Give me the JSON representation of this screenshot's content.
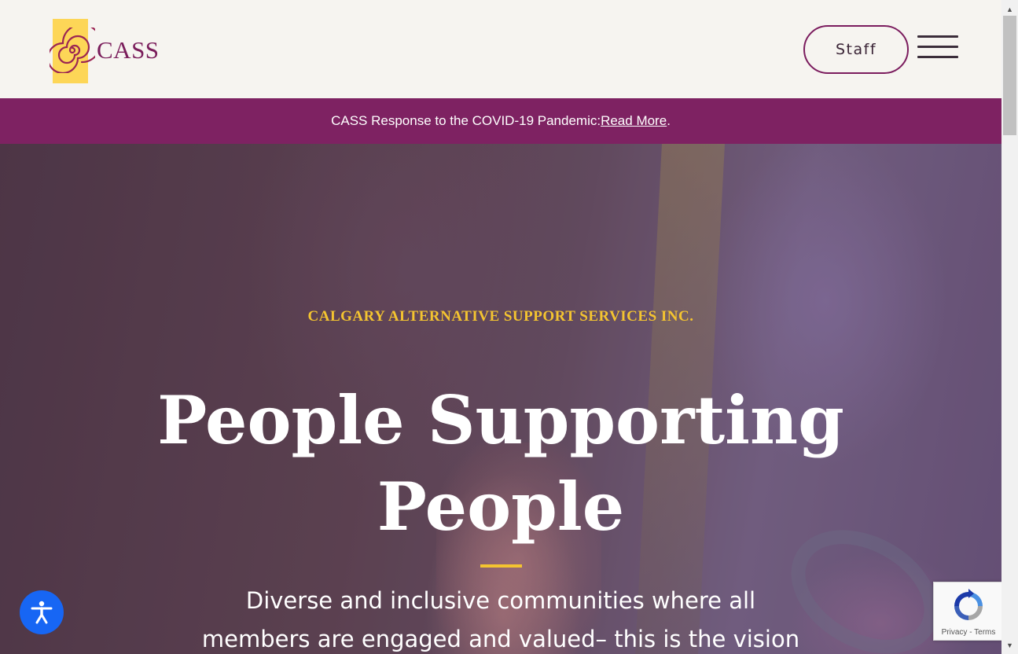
{
  "header": {
    "logo_text": "CASS",
    "staff_button": "Staff",
    "menu_icon": "hamburger-menu-icon"
  },
  "banner": {
    "text": "CASS Response to the COVID-19 Pandemic: ",
    "link_text": "Read More",
    "suffix": "."
  },
  "hero": {
    "eyebrow": "CALGARY ALTERNATIVE SUPPORT SERVICES INC.",
    "headline_line1": "People Supporting",
    "headline_line2": "People",
    "lead_line1": "Diverse and inclusive communities where all",
    "lead_line2": "members are engaged and valued– this is the vision"
  },
  "widgets": {
    "accessibility_icon": "accessibility-person-icon",
    "recaptcha_privacy": "Privacy",
    "recaptcha_separator": " - ",
    "recaptcha_terms": "Terms"
  },
  "colors": {
    "brand_purple": "#7e2262",
    "accent_gold": "#f4c430",
    "logo_yellow": "#fdd657",
    "accessibility_blue": "#1766f4"
  }
}
